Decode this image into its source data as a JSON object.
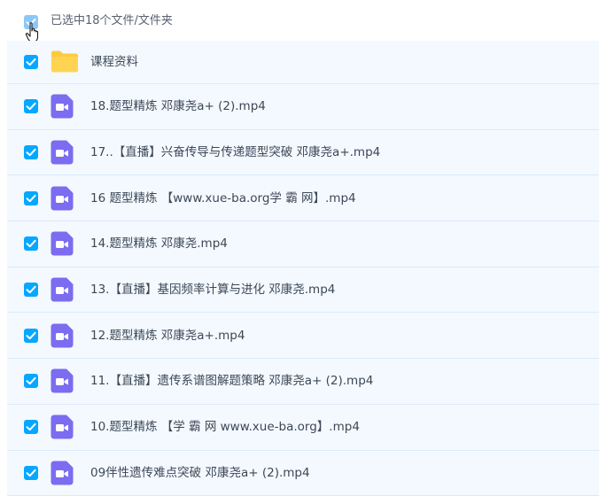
{
  "header": {
    "selection_text": "已选中18个文件/文件夹"
  },
  "files": [
    {
      "name": "课程资料",
      "icon": "folder-icon"
    },
    {
      "name": "18.题型精炼 邓康尧a+ (2).mp4",
      "icon": "video-file-icon"
    },
    {
      "name": "17..【直播】兴奋传导与传递题型突破 邓康尧a+.mp4",
      "icon": "video-file-icon"
    },
    {
      "name": "16 题型精炼 【www.xue-ba.org学 霸 网】.mp4",
      "icon": "video-file-icon"
    },
    {
      "name": "14.题型精炼 邓康尧.mp4",
      "icon": "video-file-icon"
    },
    {
      "name": "13.【直播】基因频率计算与进化 邓康尧.mp4",
      "icon": "video-file-icon"
    },
    {
      "name": "12.题型精炼 邓康尧a+.mp4",
      "icon": "video-file-icon"
    },
    {
      "name": "11.【直播】遗传系谱图解题策略 邓康尧a+ (2).mp4",
      "icon": "video-file-icon"
    },
    {
      "name": "10.题型精炼 【学 霸 网 www.xue-ba.org】.mp4",
      "icon": "video-file-icon"
    },
    {
      "name": "09伴性遗传难点突破 邓康尧a+ (2).mp4",
      "icon": "video-file-icon"
    }
  ],
  "colors": {
    "checkbox": "#06a7ff",
    "row_bg": "#f3f9ff",
    "folder": "#ffc93c",
    "video": "#7b6cf0"
  }
}
